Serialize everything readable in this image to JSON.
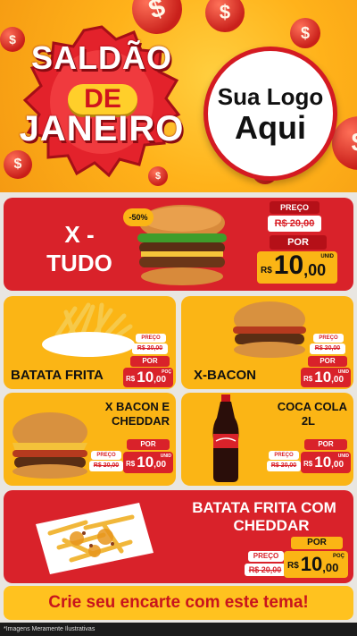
{
  "hero": {
    "title_line1": "SALDÃO",
    "title_line2": "DE",
    "title_line3": "JANEIRO",
    "logo_line1": "Sua Logo",
    "logo_line2": "Aqui",
    "coin_symbol": "$"
  },
  "featured": {
    "name_line1": "X -",
    "name_line2": "TUDO",
    "discount_badge": "-50%",
    "price_label": "PREÇO",
    "old_price": "R$ 20,00",
    "por_label": "POR",
    "currency": "R$",
    "price_int": "10",
    "price_cents": ",00",
    "unit": "UNID"
  },
  "items": [
    {
      "name": "BATATA FRITA",
      "price_label": "PREÇO",
      "old_price": "R$ 20,00",
      "por_label": "POR",
      "currency": "R$",
      "price_int": "10",
      "price_cents": ",00",
      "unit": "POÇ"
    },
    {
      "name": "X-BACON",
      "price_label": "PREÇO",
      "old_price": "R$ 20,00",
      "por_label": "POR",
      "currency": "R$",
      "price_int": "10",
      "price_cents": ",00",
      "unit": "UNID"
    },
    {
      "name_line1": "X BACON E",
      "name_line2": "CHEDDAR",
      "price_label": "PREÇO",
      "old_price": "R$ 20,00",
      "por_label": "POR",
      "currency": "R$",
      "price_int": "10",
      "price_cents": ",00",
      "unit": "UNID"
    },
    {
      "name_line1": "COCA COLA",
      "name_line2": "2L",
      "price_label": "PREÇO",
      "old_price": "R$ 20,00",
      "por_label": "POR",
      "currency": "R$",
      "price_int": "10",
      "price_cents": ",00",
      "unit": "UNID"
    }
  ],
  "bottom": {
    "name_line1": "BATATA FRITA COM",
    "name_line2": "CHEDDAR",
    "price_label": "PREÇO",
    "old_price": "R$ 20,00",
    "por_label": "POR",
    "currency": "R$",
    "price_int": "10",
    "price_cents": ",00",
    "unit": "POÇ"
  },
  "cta": "Crie seu encarte com este tema!",
  "disclaimer": "*Imagens Meramente Ilustrativas",
  "colors": {
    "red": "#d9222a",
    "yellow": "#fbb515",
    "orange": "#f59a12"
  }
}
